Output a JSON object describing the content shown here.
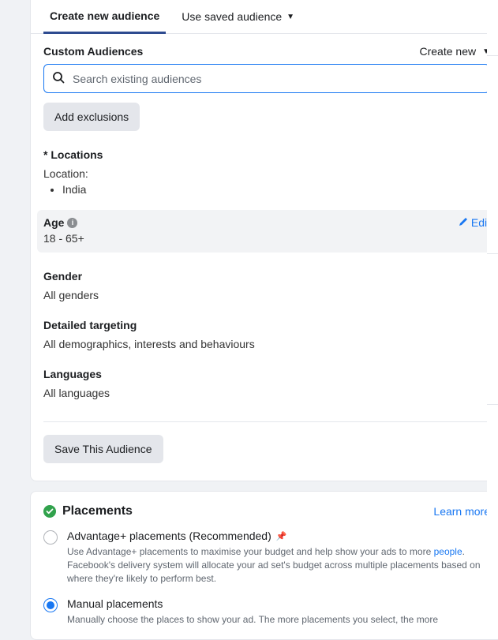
{
  "tabs": {
    "create": "Create new audience",
    "saved": "Use saved audience"
  },
  "customAudiences": {
    "label": "Custom Audiences",
    "createNew": "Create new",
    "searchPlaceholder": "Search existing audiences",
    "addExclusions": "Add exclusions"
  },
  "locations": {
    "title": "* Locations",
    "label": "Location:",
    "items": [
      "India"
    ]
  },
  "age": {
    "title": "Age",
    "value": "18 - 65+",
    "edit": "Edit"
  },
  "gender": {
    "title": "Gender",
    "value": "All genders"
  },
  "detailed": {
    "title": "Detailed targeting",
    "value": "All demographics, interests and behaviours"
  },
  "languages": {
    "title": "Languages",
    "value": "All languages"
  },
  "saveAudience": "Save This Audience",
  "placements": {
    "title": "Placements",
    "learnMore": "Learn more",
    "advantage": {
      "title": "Advantage+ placements (Recommended)",
      "descPre": "Use Advantage+ placements to maximise your budget and help show your ads to more ",
      "peopleLink": "people",
      "descPost": ". Facebook's delivery system will allocate your ad set's budget across multiple placements based on where they're likely to perform best."
    },
    "manual": {
      "title": "Manual placements",
      "desc": "Manually choose the places to show your ad. The more placements you select, the more"
    }
  }
}
